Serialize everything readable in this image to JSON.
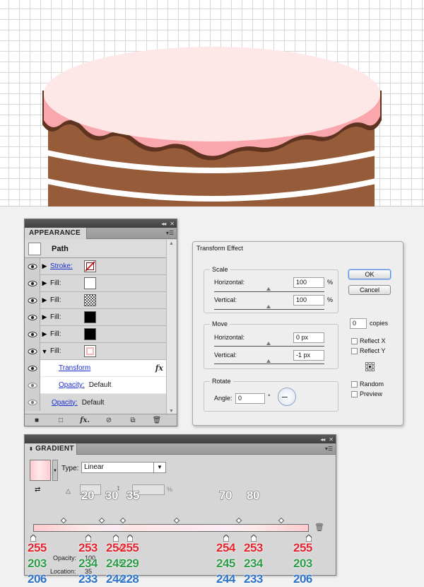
{
  "artboard": {
    "colors": {
      "frosting": "#fde8e7",
      "frosting_drip": "#f9a7ad",
      "cake": "#965b38",
      "cake_shadow": "#6a3a22",
      "stripe": "#ffffff"
    }
  },
  "appearance": {
    "tab_label": "APPEARANCE",
    "path_label": "Path",
    "rows": [
      {
        "label": "Stroke:",
        "swatch": "none-red-slash"
      },
      {
        "label": "Fill:",
        "swatch": "#ffffff"
      },
      {
        "label": "Fill:",
        "swatch": "checker"
      },
      {
        "label": "Fill:",
        "swatch": "#000000"
      },
      {
        "label": "Fill:",
        "swatch": "#000000"
      },
      {
        "label": "Fill:",
        "swatch": "pink-gradient"
      }
    ],
    "transform_label": "Transform",
    "fx_symbol": "fx",
    "inner_opacity_label": "Opacity:",
    "inner_opacity_value": "Default",
    "opacity_label": "Opacity:",
    "opacity_value": "Default",
    "footer_icons": [
      "square-icon",
      "new-layer-icon",
      "fx-icon",
      "clear-icon",
      "duplicate-icon",
      "trash-icon"
    ]
  },
  "transform_dialog": {
    "title": "Transform Effect",
    "scale": {
      "title": "Scale",
      "horizontal_label": "Horizontal:",
      "horizontal_value": "100",
      "vertical_label": "Vertical:",
      "vertical_value": "100",
      "unit": "%"
    },
    "move": {
      "title": "Move",
      "horizontal_label": "Horizontal:",
      "horizontal_value": "0 px",
      "vertical_label": "Vertical:",
      "vertical_value": "-1 px"
    },
    "rotate": {
      "title": "Rotate",
      "angle_label": "Angle:",
      "angle_value": "0",
      "unit": "°"
    },
    "ok_label": "OK",
    "cancel_label": "Cancel",
    "copies_value": "0",
    "copies_label": "copies",
    "reflect_x_label": "Reflect X",
    "reflect_y_label": "Reflect Y",
    "random_label": "Random",
    "preview_label": "Preview"
  },
  "gradient": {
    "tab_label": "GRADIENT",
    "type_label": "Type:",
    "type_value": "Linear",
    "opacity_label": "Opacity:",
    "opacity_value": "100",
    "opacity_unit": "%",
    "location_label": "Location:",
    "location_value": "35",
    "angle_unit": "%",
    "midpoints_top": [
      "20",
      "30",
      "35",
      "70",
      "80"
    ],
    "stops": [
      {
        "location": 0,
        "r": "255",
        "g": "203",
        "b": "206"
      },
      {
        "location": 20,
        "r": "253",
        "g": "234",
        "b": "233"
      },
      {
        "location": 30,
        "r": "254",
        "g": "245",
        "b": "244"
      },
      {
        "location": 35,
        "r": "255",
        "g": "229",
        "b": "228"
      },
      {
        "location": 70,
        "r": "254",
        "g": "245",
        "b": "244"
      },
      {
        "location": 80,
        "r": "253",
        "g": "234",
        "b": "233"
      },
      {
        "location": 100,
        "r": "255",
        "g": "203",
        "b": "206"
      }
    ]
  }
}
